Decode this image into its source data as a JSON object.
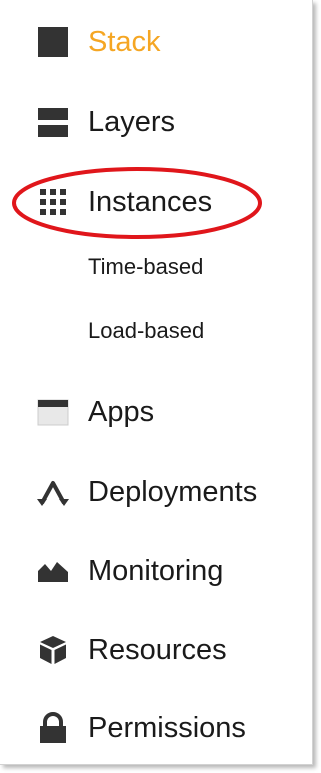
{
  "nav": {
    "active_color": "#f5a623",
    "items": [
      {
        "label": "Stack",
        "icon": "square-icon",
        "active": true
      },
      {
        "label": "Layers",
        "icon": "layers-icon"
      },
      {
        "label": "Instances",
        "icon": "grid-icon",
        "highlighted": true,
        "subitems": [
          {
            "label": "Time-based"
          },
          {
            "label": "Load-based"
          }
        ]
      },
      {
        "label": "Apps",
        "icon": "window-icon"
      },
      {
        "label": "Deployments",
        "icon": "deploy-icon"
      },
      {
        "label": "Monitoring",
        "icon": "mountain-icon"
      },
      {
        "label": "Resources",
        "icon": "cube-icon"
      },
      {
        "label": "Permissions",
        "icon": "lock-icon"
      }
    ]
  },
  "annotation": {
    "highlight_color": "#e0161b"
  }
}
